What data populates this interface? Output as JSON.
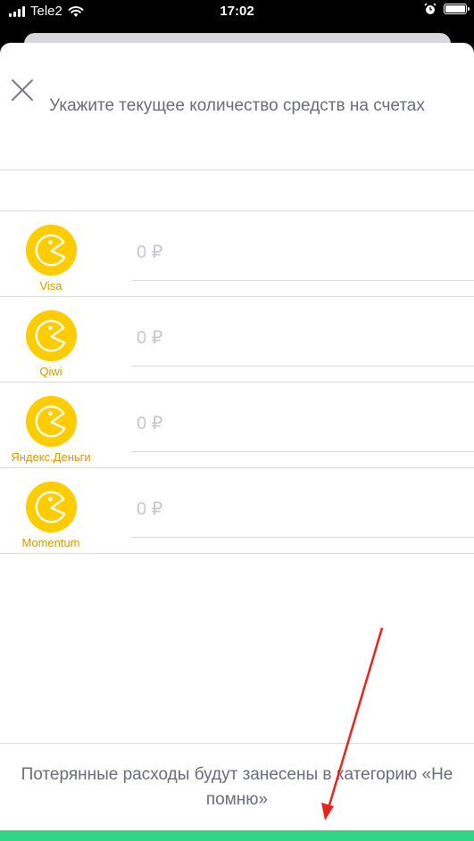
{
  "status_bar": {
    "carrier": "Tele2",
    "time": "17:02",
    "signal_icon": "signal-bars-icon",
    "wifi_icon": "wifi-icon",
    "alarm_icon": "alarm-clock-icon",
    "battery_icon": "battery-icon",
    "battery_level": 1.0
  },
  "header": {
    "title": "Укажите текущее количество средств на счетах",
    "close_icon": "close-icon"
  },
  "accounts": [
    {
      "name": "Visa",
      "amount": "0 ₽",
      "icon": "pacman-coin-icon"
    },
    {
      "name": "Qiwi",
      "amount": "0 ₽",
      "icon": "pacman-coin-icon"
    },
    {
      "name": "Яндекс.Деньги",
      "amount": "0 ₽",
      "icon": "pacman-coin-icon"
    },
    {
      "name": "Momentum",
      "amount": "0 ₽",
      "icon": "pacman-coin-icon"
    }
  ],
  "footer": {
    "note": "Потерянные расходы будут занесены в категорию «Не помню»"
  },
  "colors": {
    "accent_green": "#2fd685",
    "coin_yellow": "#ffcc00",
    "label_gold": "#d49a00",
    "annotation_red": "#e8231c"
  }
}
